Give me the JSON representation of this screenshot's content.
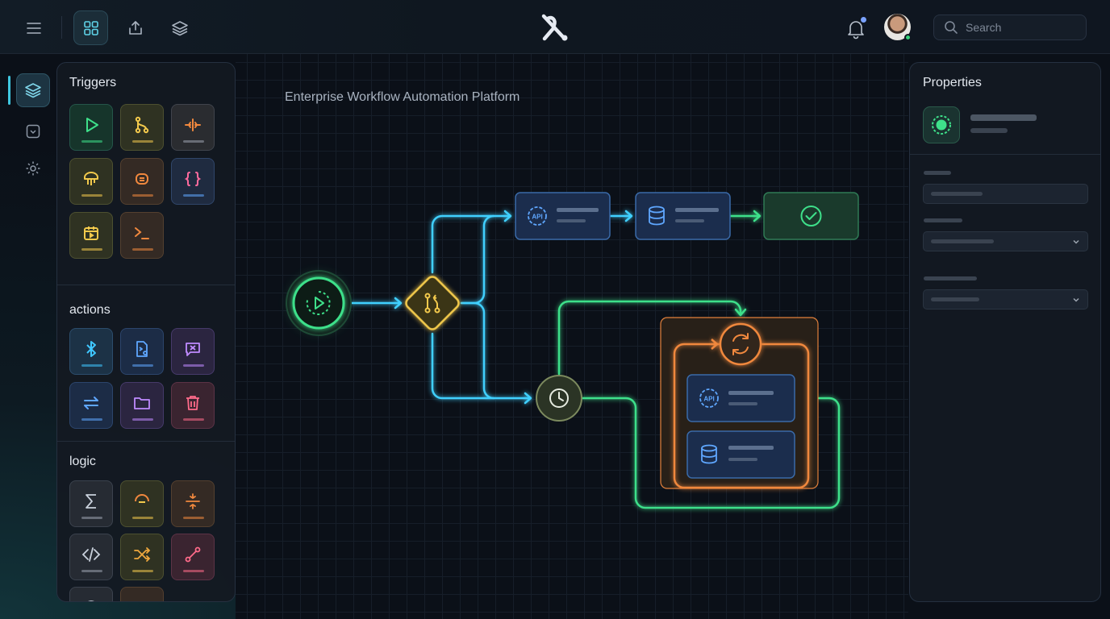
{
  "app": {
    "canvas_title": "Enterprise Workflow Automation Platform"
  },
  "topbar": {
    "menu_icon": "hamburger-menu-icon",
    "grid_icon": "grid-icon",
    "share_icon": "share-upload-icon",
    "layers_icon": "layers-icon",
    "search_placeholder": "Search"
  },
  "sidebar": {
    "sections": [
      {
        "title": "Triggers",
        "tiles": [
          "play-icon",
          "git-merge-icon",
          "split-icon",
          "webhook-icon",
          "bot-icon",
          "braces-icon",
          "calendar-icon",
          "terminal-icon"
        ]
      },
      {
        "title": "actions",
        "tiles": [
          "bluetooth-icon",
          "file-code-icon",
          "message-x-icon",
          "transfer-icon",
          "folder-icon",
          "trash-icon"
        ]
      },
      {
        "title": "logic",
        "tiles": [
          "sigma-icon",
          "half-circle-icon",
          "split-vertical-icon",
          "code-icon",
          "shuffle-icon",
          "route-icon"
        ]
      }
    ]
  },
  "properties": {
    "title": "Properties"
  },
  "colors": {
    "cyan": "#3fd0ff",
    "green": "#3ee08a",
    "yellow": "#f2c94c",
    "orange": "#f0883e",
    "blue_node": "#1d3557"
  }
}
